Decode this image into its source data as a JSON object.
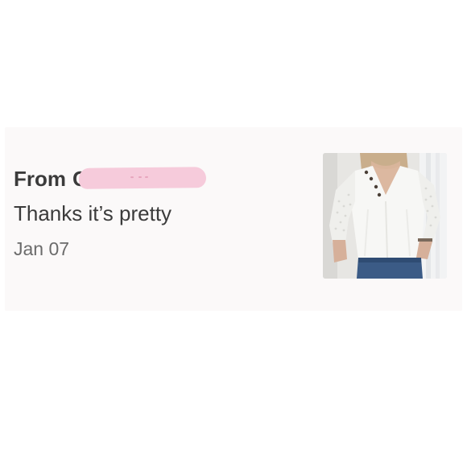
{
  "message_card": {
    "from_label": "From",
    "sender_name": "Ci",
    "message_text": "Thanks it’s pretty",
    "date": "Jan 07"
  },
  "product_thumbnail": {
    "icon": "product-photo-white-blouse"
  },
  "colors": {
    "card_background": "#fbf9f9",
    "text_primary": "#3b3b3b",
    "text_secondary": "#6b6b6b",
    "redaction": "#f6cbdb"
  }
}
